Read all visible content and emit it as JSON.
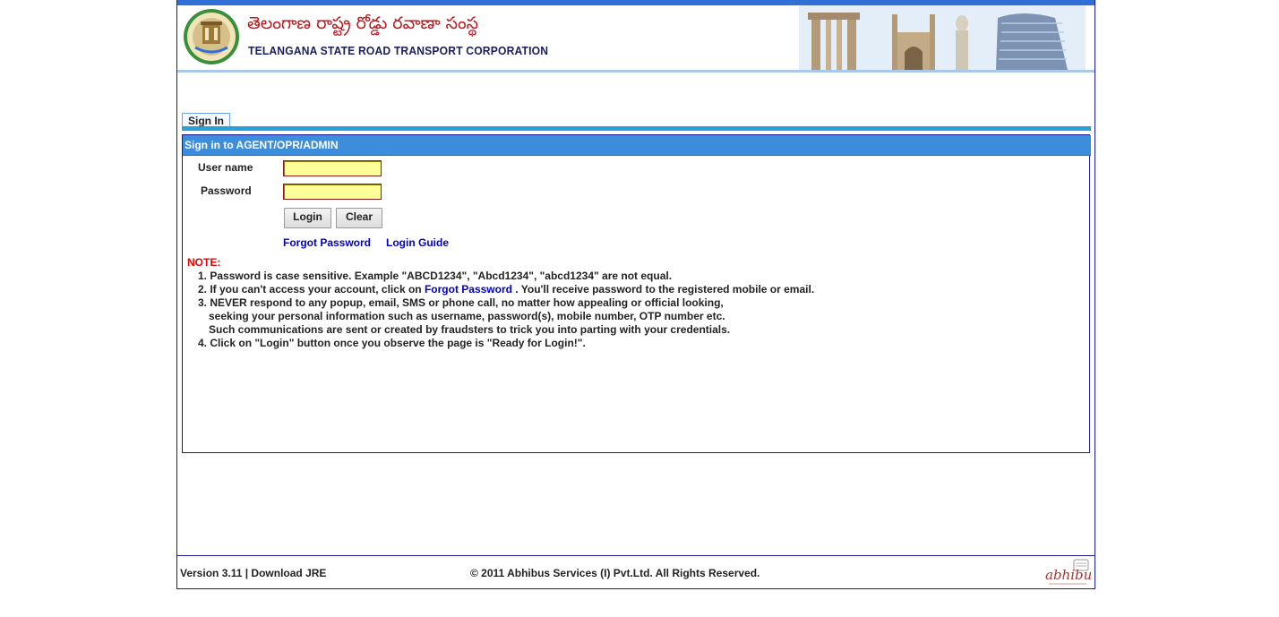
{
  "header": {
    "telugu_title": "తెలంగాణ రాష్ట్ర రోడ్డు రవాణా సంస్థ",
    "english_title": "TELANGANA STATE ROAD TRANSPORT CORPORATION"
  },
  "tabs": [
    {
      "label": "Sign In"
    }
  ],
  "panel": {
    "title": "Sign in to AGENT/OPR/ADMIN",
    "username_label": "User name",
    "password_label": "Password",
    "username_value": "",
    "password_value": "",
    "login_button": "Login",
    "clear_button": "Clear",
    "forgot_link": "Forgot Password",
    "guide_link": "Login Guide"
  },
  "notes": {
    "title": "NOTE:",
    "line1": "1. Password is case sensitive. Example \"ABCD1234\", \"Abcd1234\", \"abcd1234\" are not equal.",
    "line2_pre": "2. If you can't access your account, click on ",
    "line2_link": "Forgot Password .",
    "line2_post": "  You'll receive password to the registered mobile or email.",
    "line3a": "3. NEVER respond to any popup, email, SMS or phone call, no matter how appealing or official looking,",
    "line3b": "seeking your personal information such as username, password(s), mobile number, OTP number etc.",
    "line3c": "Such communications are sent or created by fraudsters to trick you into parting with your credentials.",
    "line4": "4. Click on \"Login\" button once you observe the page is \"Ready for Login!\"."
  },
  "footer": {
    "version": "Version 3.11",
    "separator": " | ",
    "download": "Download JRE",
    "copyright": "© 2011 Abhibus Services (I) Pvt.Ltd.  All Rights Reserved.",
    "brand_logo_text": "abhibus"
  },
  "colors": {
    "top_bar": "#2f6fd6",
    "panel_header": "#3d8ddd",
    "field_bg": "#ffff99",
    "link": "#0000cc",
    "note_red": "#e00000"
  }
}
